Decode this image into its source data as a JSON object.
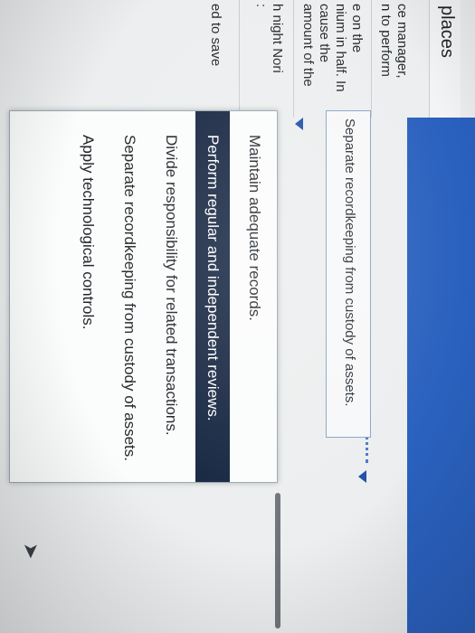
{
  "header": {
    "title_fragment": "places"
  },
  "left_column": {
    "lines": [
      "ce manager,",
      "n to perform",
      "e on the",
      "nium in half. In",
      "cause the",
      "amount of the",
      "h night Nori",
      ":",
      "ed to save"
    ]
  },
  "answer": {
    "selected_text": "Separate recordkeeping from custody of assets."
  },
  "dropdown": {
    "options": [
      "Maintain adequate records.",
      "Perform regular and independent reviews.",
      "Divide responsibility for related transactions.",
      "Separate recordkeeping from custody of assets.",
      "Apply technological controls."
    ],
    "highlighted_index": 1
  },
  "colors": {
    "header_blue": "#2a61bf",
    "highlight": "#14243f",
    "border": "#8aa4c9"
  }
}
